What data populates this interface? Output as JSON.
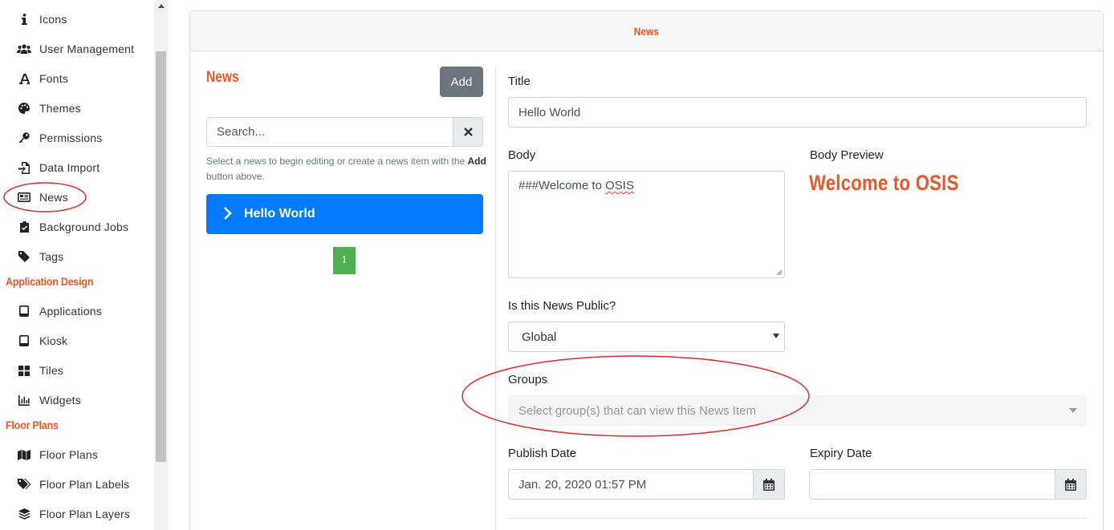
{
  "sidebar": {
    "items": [
      {
        "label": "Icons",
        "icon": "info-icon"
      },
      {
        "label": "User Management",
        "icon": "users-icon"
      },
      {
        "label": "Fonts",
        "icon": "font-icon"
      },
      {
        "label": "Themes",
        "icon": "palette-icon"
      },
      {
        "label": "Permissions",
        "icon": "key-icon"
      },
      {
        "label": "Data Import",
        "icon": "file-import-icon"
      },
      {
        "label": "News",
        "icon": "newspaper-icon"
      },
      {
        "label": "Background Jobs",
        "icon": "clipboard-check-icon"
      },
      {
        "label": "Tags",
        "icon": "tag-icon"
      }
    ],
    "application_design": {
      "title": "Application Design",
      "items": [
        {
          "label": "Applications",
          "icon": "tablet-icon"
        },
        {
          "label": "Kiosk",
          "icon": "tablet-icon"
        },
        {
          "label": "Tiles",
          "icon": "grid-icon"
        },
        {
          "label": "Widgets",
          "icon": "bar-chart-icon"
        }
      ]
    },
    "floor_plans": {
      "title": "Floor Plans",
      "items": [
        {
          "label": "Floor Plans",
          "icon": "map-icon"
        },
        {
          "label": "Floor Plan Labels",
          "icon": "tags-icon"
        },
        {
          "label": "Floor Plan Layers",
          "icon": "layers-icon"
        }
      ]
    }
  },
  "card": {
    "header_title": "News"
  },
  "list": {
    "heading": "News",
    "add_label": "Add",
    "search_placeholder": "Search...",
    "help_text_pre": "Select a news to begin editing or create a news item with the ",
    "help_text_bold": "Add",
    "help_text_post": " button above.",
    "items": [
      {
        "label": "Hello World"
      }
    ],
    "page": "1"
  },
  "form": {
    "title_label": "Title",
    "title_value": "Hello World",
    "body_label": "Body",
    "body_value_prefix": "###Welcome to ",
    "body_value_misspelled": "OSIS",
    "preview_label": "Body Preview",
    "preview_title": "Welcome to OSIS",
    "public_label": "Is this News Public?",
    "public_value": "Global",
    "groups_label": "Groups",
    "groups_placeholder": "Select group(s) that can view this News Item",
    "publish_label": "Publish Date",
    "publish_value": "Jan. 20, 2020 01:57 PM",
    "expiry_label": "Expiry Date",
    "expiry_value": ""
  },
  "colors": {
    "accent": "#e8572a",
    "primary": "#007bff",
    "success": "#4caf50",
    "secondary": "#6c757d",
    "annotation": "#d32f2f"
  }
}
